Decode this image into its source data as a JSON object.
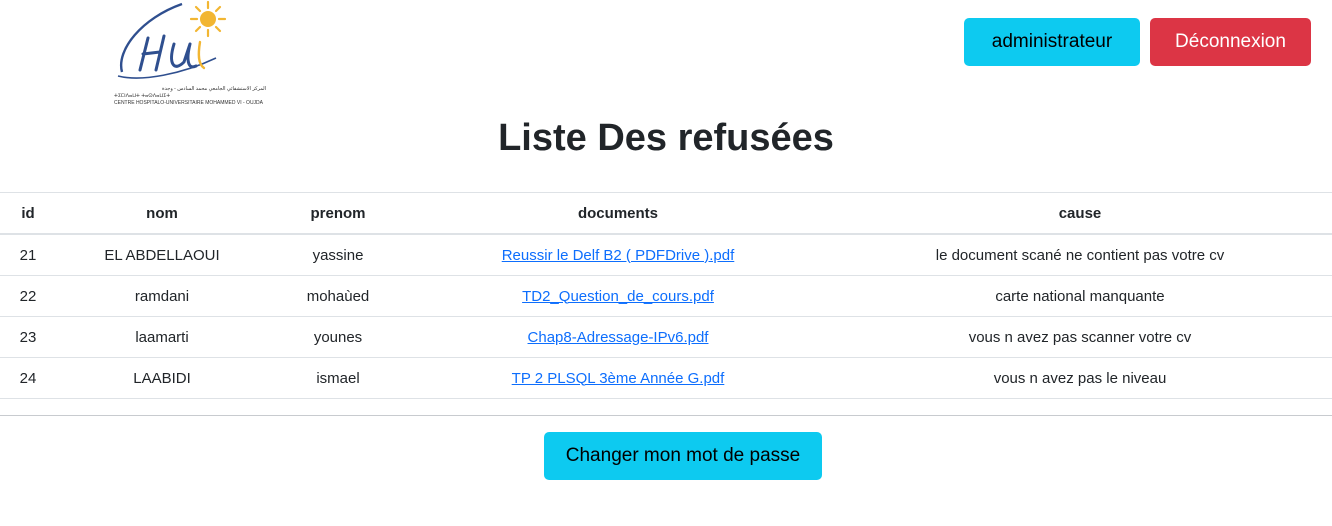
{
  "header": {
    "logo": {
      "mark": "Hu",
      "caption_arabic": "المركز الاستشفائي الجامعي محمد السادس - وجدة",
      "caption_tifinagh": "ⵜⵉⵎⵏⴷⴰⵡⵜ ⵜⴰⵙⴷⴰⵡⵉⵜ",
      "caption_french": "CENTRE HOSPITALO-UNIVERSITAIRE MOHAMMED VI - OUJDA",
      "sun_color": "#f2b632",
      "mark_color": "#2f4f8f"
    },
    "admin_label": "administrateur",
    "logout_label": "Déconnexion"
  },
  "page": {
    "title": "Liste Des refusées"
  },
  "table": {
    "headers": {
      "id": "id",
      "nom": "nom",
      "prenom": "prenom",
      "documents": "documents",
      "cause": "cause"
    },
    "rows": [
      {
        "id": "21",
        "nom": "EL ABDELLAOUI",
        "prenom": "yassine",
        "document": "Reussir le Delf B2 ( PDFDrive ).pdf",
        "cause": "le document scané ne contient pas votre cv"
      },
      {
        "id": "22",
        "nom": "ramdani",
        "prenom": "mohaùed",
        "document": "TD2_Question_de_cours.pdf",
        "cause": "carte national manquante"
      },
      {
        "id": "23",
        "nom": "laamarti",
        "prenom": "younes",
        "document": "Chap8-Adressage-IPv6.pdf",
        "cause": "vous n avez pas scanner votre cv"
      },
      {
        "id": "24",
        "nom": "LAABIDI",
        "prenom": "ismael",
        "document": "TP 2 PLSQL 3ème Année G.pdf",
        "cause": "vous n avez pas le niveau"
      }
    ]
  },
  "footer": {
    "change_password_label": "Changer mon mot de passe"
  },
  "colors": {
    "info": "#0dcaf0",
    "danger": "#dc3545",
    "link": "#0d6efd",
    "border": "#dee2e6"
  }
}
